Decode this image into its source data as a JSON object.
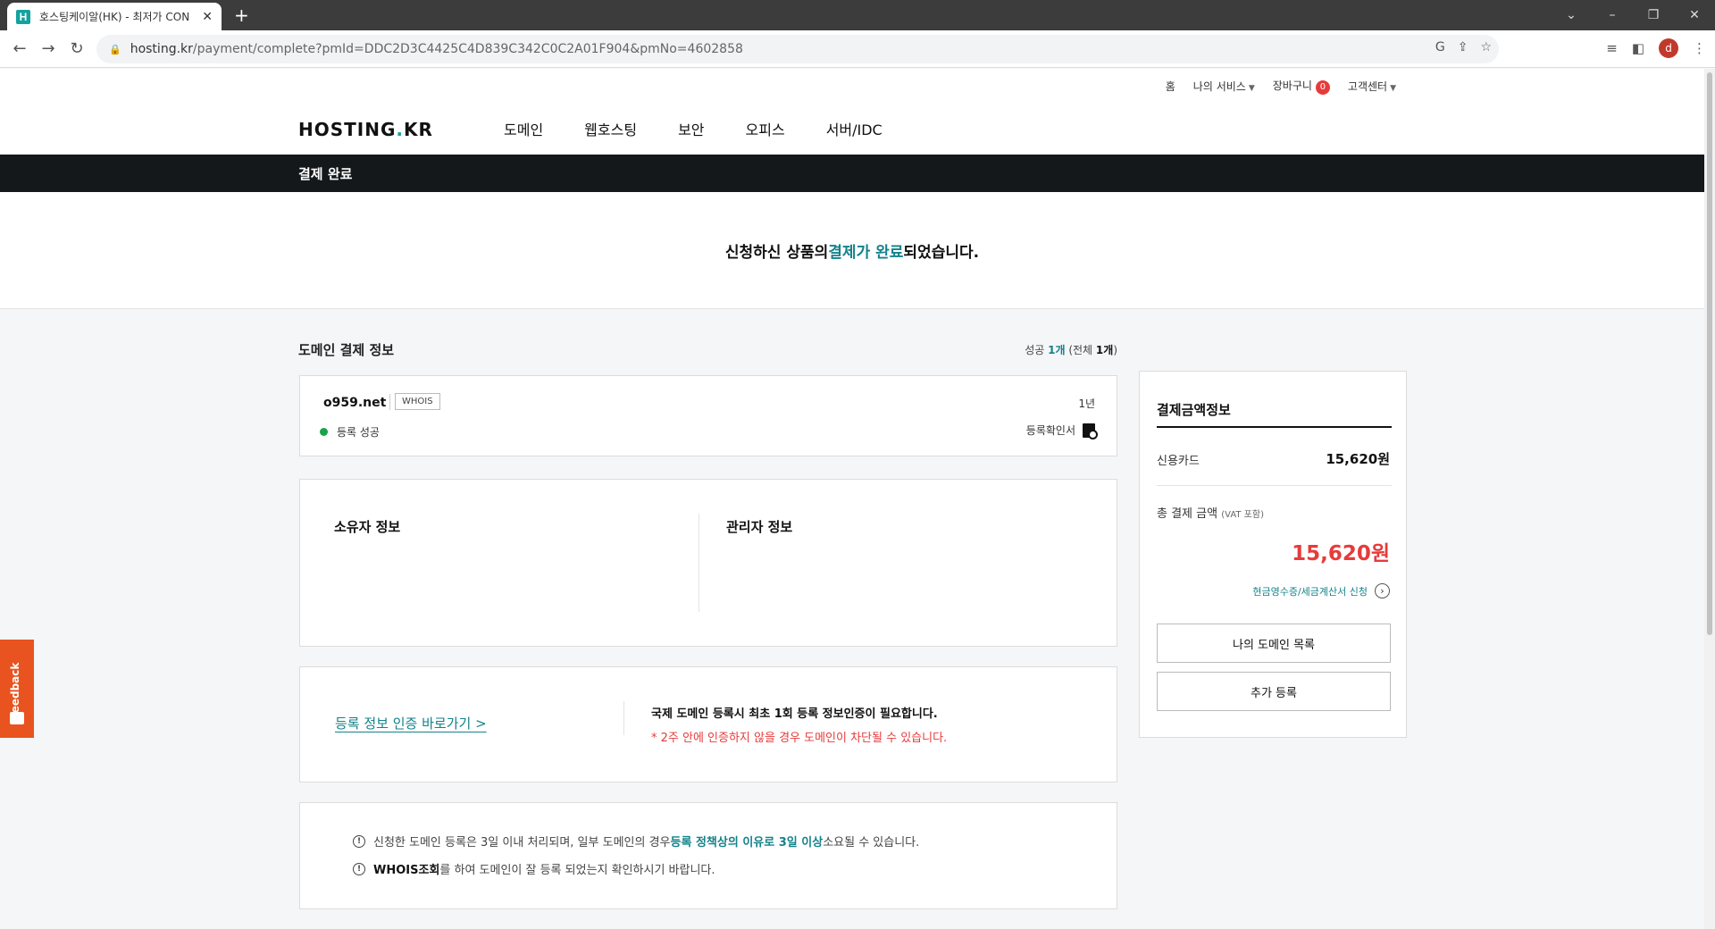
{
  "browser": {
    "tab_title": "호스팅케이알(HK) - 최저가 CON",
    "favicon_letter": "H",
    "url_main": "hosting.kr",
    "url_rest": "/payment/complete?pmId=DDC2D3C4425C4D839C342C0C2A01F904&pmNo=4602858",
    "profile_letter": "d"
  },
  "util_nav": {
    "home": "홈",
    "my_service": "나의 서비스",
    "cart": "장바구니",
    "cart_count": "0",
    "support": "고객센터"
  },
  "logo": {
    "main": "HOSTING",
    "dot": ".",
    "suffix": "KR"
  },
  "gnb": [
    "도메인",
    "웹호스팅",
    "보안",
    "오피스",
    "서버/IDC"
  ],
  "page_title": "결제 완료",
  "complete_msg": {
    "pre": "신청하신 상품의 ",
    "highlight": "결제가 완료",
    "post": "되었습니다."
  },
  "domain_section": {
    "title": "도메인 결제 정보",
    "count_success_label": "성공 ",
    "count_success": "1개",
    "count_total_pre": " (전체 ",
    "count_total": "1개",
    "count_total_post": ")",
    "domain_name": "o959.net",
    "whois_label": "WHOIS",
    "status": "등록 성공",
    "period": "1년",
    "certificate": "등록확인서"
  },
  "owner": {
    "owner_title": "소유자 정보",
    "admin_title": "관리자 정보"
  },
  "verify": {
    "link": "등록 정보 인증 바로가기 >",
    "msg1": "국제 도메인 등록시 최초 1회 등록 정보인증이 필요합니다.",
    "msg2": "* 2주 안에 인증하지 않을 경우 도메인이 차단될 수 있습니다."
  },
  "notices": {
    "n1_pre": "신청한 도메인 등록은 3일 이내 처리되며, 일부 도메인의 경우 ",
    "n1_hl": "등록 정책상의 이유로 3일 이상",
    "n1_post": " 소요될 수 있습니다.",
    "n2_bold": "WHOIS조회",
    "n2_post": "를 하여 도메인이 잘 등록 되었는지 확인하시기 바랍니다."
  },
  "payment": {
    "title": "결제금액정보",
    "card_label": "신용카드",
    "card_value": "15,620원",
    "total_label": "총 결제 금액",
    "total_vat": "(VAT 포함)",
    "total_value": "15,620원",
    "receipt": "현금영수증/세금계산서 신청",
    "btn_my_domains": "나의 도메인 목록",
    "btn_add": "추가 등록"
  },
  "feedback_label": "Feedback"
}
